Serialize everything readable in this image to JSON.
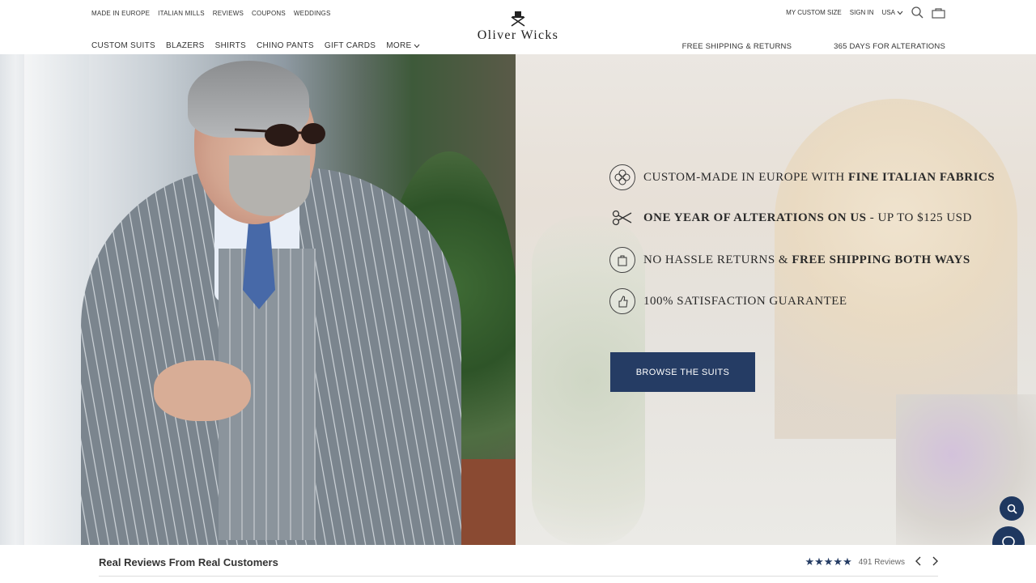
{
  "header": {
    "top_links": [
      "MADE IN EUROPE",
      "ITALIAN MILLS",
      "REVIEWS",
      "COUPONS",
      "WEDDINGS"
    ],
    "main_nav": [
      "CUSTOM SUITS",
      "BLAZERS",
      "SHIRTS",
      "CHINO PANTS",
      "GIFT CARDS",
      "MORE"
    ],
    "logo_text": "Oliver Wicks",
    "account": {
      "custom_size": "MY CUSTOM SIZE",
      "sign_in": "SIGN IN",
      "region": "USA"
    },
    "promos": [
      "FREE SHIPPING & RETURNS",
      "365 DAYS FOR ALTERATIONS"
    ]
  },
  "hero": {
    "features": [
      {
        "icon": "flower-icon",
        "text_a": "Custom-made in Europe with ",
        "text_b": "Fine Italian Fabrics",
        "text_c": ""
      },
      {
        "icon": "scissors-icon",
        "text_a": "",
        "text_b": "One Year of Alterations on Us",
        "text_c": " - up to $125 USD"
      },
      {
        "icon": "returns-bag-icon",
        "text_a": "No Hassle Returns & ",
        "text_b": "Free Shipping Both Ways",
        "text_c": ""
      },
      {
        "icon": "thumbs-up-badge-icon",
        "text_a": "100% Satisfaction Guarantee",
        "text_b": "",
        "text_c": ""
      }
    ],
    "cta_label": "BROWSE THE SUITS"
  },
  "reviews": {
    "title": "Real Reviews From Real Customers",
    "stars": "★★★★★",
    "count_label": "491 Reviews"
  },
  "colors": {
    "brand_navy": "#253c64",
    "fab_navy": "#1f3860"
  }
}
